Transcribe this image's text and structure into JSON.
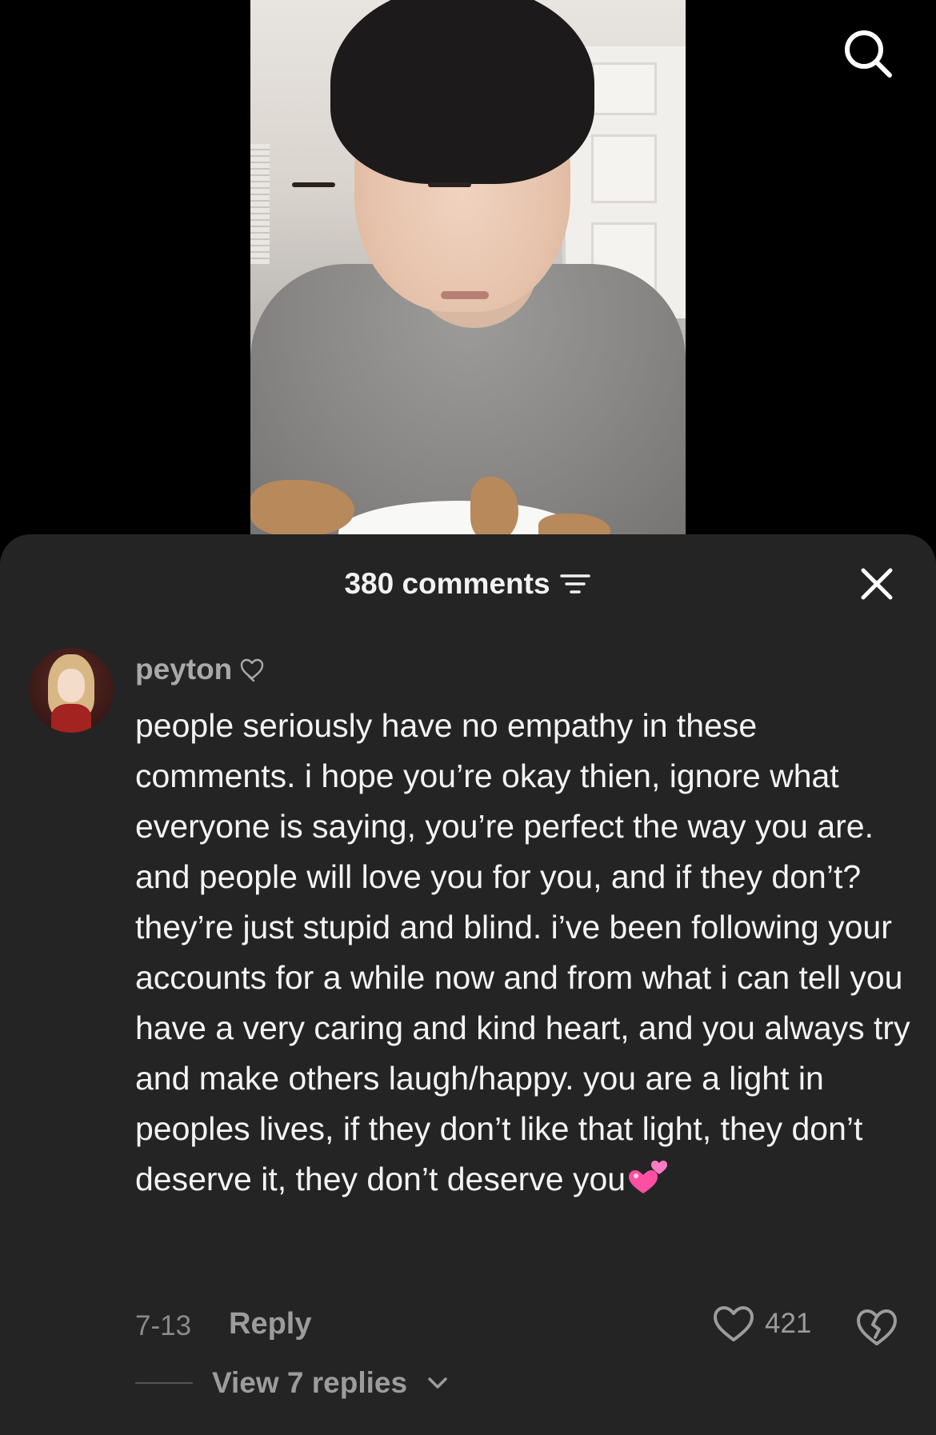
{
  "video": {},
  "search": {
    "icon": "search-icon"
  },
  "comments_sheet": {
    "title": "380 comments",
    "filter_icon": "filter-icon",
    "close_icon": "close-icon"
  },
  "comment": {
    "username": "peyton",
    "badge_icon": "heart-outline-icon",
    "text": "people seriously have no empathy in these comments. i hope you’re okay thien, ignore what everyone is saying, you’re perfect the way you are. and people will love you for you, and if they don’t? they’re just stupid and blind. i’ve been following your accounts for a while now and from what i can tell you have a very caring and kind heart, and you always try and make others laugh/happy. you are a light in peoples lives, if they don’t like that light, they don’t deserve it, they don’t deserve you",
    "emoji": "two-hearts-emoji",
    "date": "7-13",
    "reply_label": "Reply",
    "like_count": "421",
    "view_replies_label": "View 7 replies"
  },
  "colors": {
    "sheet_bg": "#242424",
    "primary_text": "#f4f4f4",
    "secondary_text": "#9c9c9c",
    "emoji_pink": "#ff4fa3"
  }
}
